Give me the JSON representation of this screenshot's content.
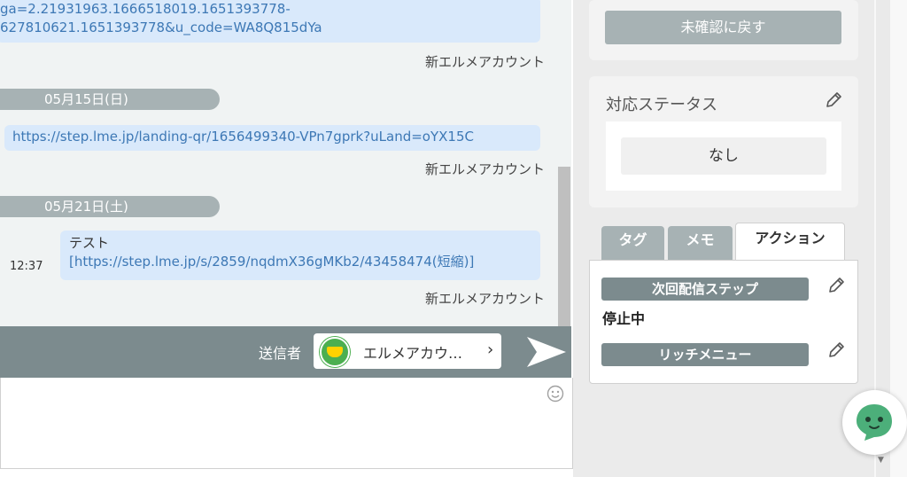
{
  "chat": {
    "messages": [
      {
        "lines": [
          "ga=2.21931963.1666518019.1651393778-",
          "627810621.1651393778&u_code=WA8Q815dYa"
        ],
        "sender": "新エルメアカウント"
      },
      {
        "date": "05月15日(日)",
        "lines": [
          "https://step.lme.jp/landing-qr/1656499340-VPn7gprk?uLand=oYX15C"
        ],
        "sender": "新エルメアカウント"
      },
      {
        "date": "05月21日(土)",
        "time": "12:37",
        "lines": [
          "テスト",
          "[https://step.lme.jp/s/2859/nqdmX36gMKb2/43458474(短縮)]"
        ],
        "sender": "新エルメアカウント"
      }
    ]
  },
  "send_bar": {
    "sender_label": "送信者",
    "sender_name": "エルメアカウ…",
    "chevron": "›",
    "avatar_icon": "account-avatar-icon",
    "send_icon": "send-arrow-icon"
  },
  "composer": {
    "placeholder": "",
    "emoji_icon": "smiley-icon"
  },
  "side_panel": {
    "unconfirm_button": "未確認に戻す",
    "status": {
      "title": "対応ステータス",
      "value": "なし"
    },
    "tabs": [
      {
        "label": "タグ",
        "active": false
      },
      {
        "label": "メモ",
        "active": false
      },
      {
        "label": "アクション",
        "active": true
      }
    ],
    "actions": {
      "next_step_label": "次回配信ステップ",
      "next_step_status": "停止中",
      "rich_menu_label": "リッチメニュー"
    }
  },
  "colors": {
    "bubble": "#d9e9fb",
    "link_text": "#3d78b5",
    "date_pill": "#a7b2b4",
    "send_bar": "#7c8b8e",
    "chatbot_green": "#4caf7a"
  }
}
